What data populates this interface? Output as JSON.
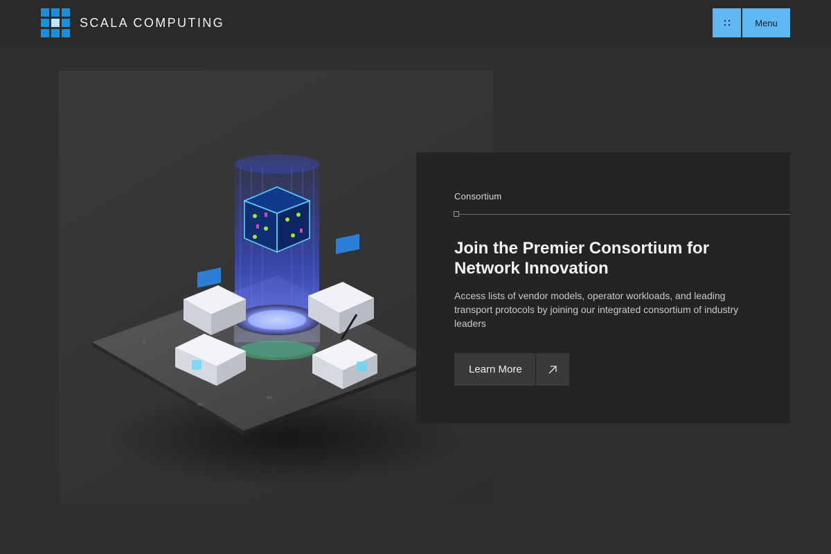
{
  "header": {
    "brand": "SCALA COMPUTING",
    "logo_icon": "grid-logo-icon",
    "menu_label": "Menu",
    "menu_icon": "dots-grid-icon",
    "accent_color": "#5fb8f2",
    "logo_color": "#1b8fd8"
  },
  "hero": {
    "image": "isometric-consortium-illustration"
  },
  "card": {
    "eyebrow": "Consortium",
    "title": "Join the Premier Consortium for Network Innovation",
    "description": "Access lists of vendor models, operator workloads, and leading transport protocols by joining our integrated consortium of industry leaders",
    "cta_label": "Learn More",
    "cta_icon": "arrow-up-right-icon"
  }
}
